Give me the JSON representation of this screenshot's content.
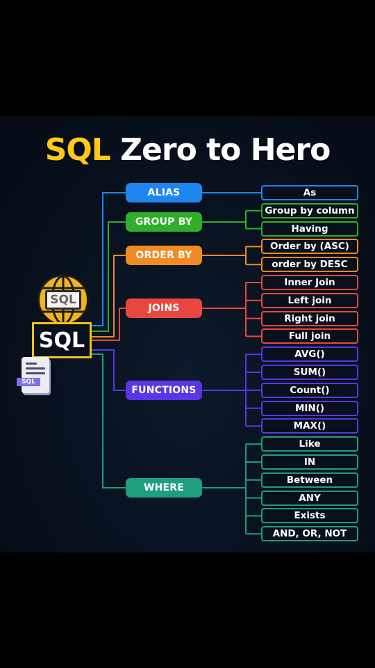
{
  "title": {
    "accent": "SQL",
    "rest": " Zero to Hero"
  },
  "root": {
    "label": "SQL",
    "globe_label": "SQL",
    "doc_label": "SQL"
  },
  "icons": [
    "globe-sql-icon",
    "document-sql-icon"
  ],
  "branches": [
    {
      "label": "ALIAS",
      "color": "#1f86f0",
      "items": [
        "As"
      ]
    },
    {
      "label": "GROUP BY",
      "color": "#2db02a",
      "items": [
        "Group by column",
        "Having"
      ]
    },
    {
      "label": "ORDER BY",
      "color": "#f08a24",
      "items": [
        "Order by (ASC)",
        "order by DESC"
      ]
    },
    {
      "label": "JOINS",
      "color": "#e8473f",
      "items": [
        "Inner Join",
        "Left join",
        "Right join",
        "Full join"
      ]
    },
    {
      "label": "FUNCTIONS",
      "color": "#5a36e6",
      "items": [
        "AVG()",
        "SUM()",
        "Count()",
        "MIN()",
        "MAX()"
      ]
    },
    {
      "label": "WHERE",
      "color": "#1f9e7e",
      "items": [
        "Like",
        "IN",
        "Between",
        "ANY",
        "Exists",
        "AND, OR, NOT"
      ]
    }
  ]
}
